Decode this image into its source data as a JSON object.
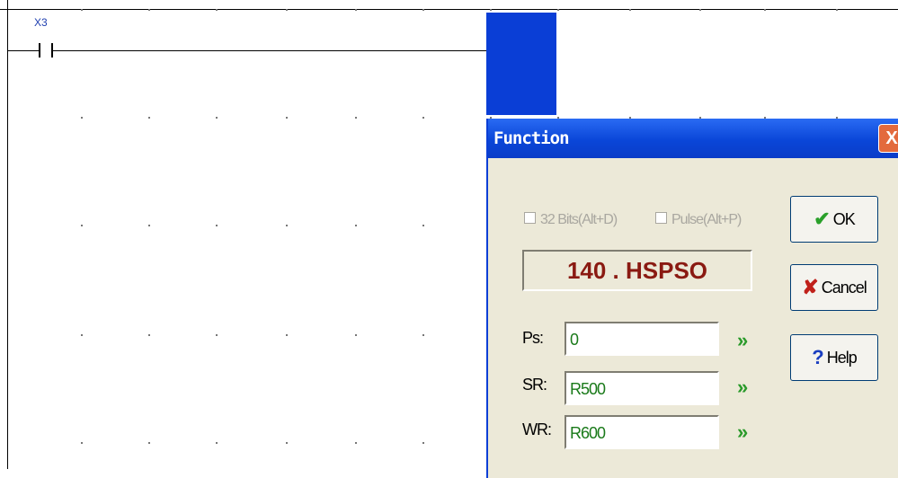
{
  "ladder": {
    "contact_label": "X3"
  },
  "dialog": {
    "title": "Function",
    "close_glyph": "X",
    "option_32bit": "32 Bits(Alt+D)",
    "option_pulse": "Pulse(Alt+P)",
    "function_name": "140 . HSPSO",
    "params": [
      {
        "label": "Ps:",
        "value": "0"
      },
      {
        "label": "SR:",
        "value": "R500"
      },
      {
        "label": "WR:",
        "value": "R600"
      }
    ],
    "arrow_glyph": "»",
    "ok_label": "OK",
    "cancel_label": "Cancel",
    "help_label": "Help",
    "ok_icon": "checkmark-icon",
    "cancel_icon": "x-mark-icon",
    "help_icon": "question-icon"
  },
  "colors": {
    "cursor": "#0a3ed6",
    "title_bar": "#0a46d8",
    "function_text": "#8a1a12",
    "param_text": "#1a7a1a"
  }
}
